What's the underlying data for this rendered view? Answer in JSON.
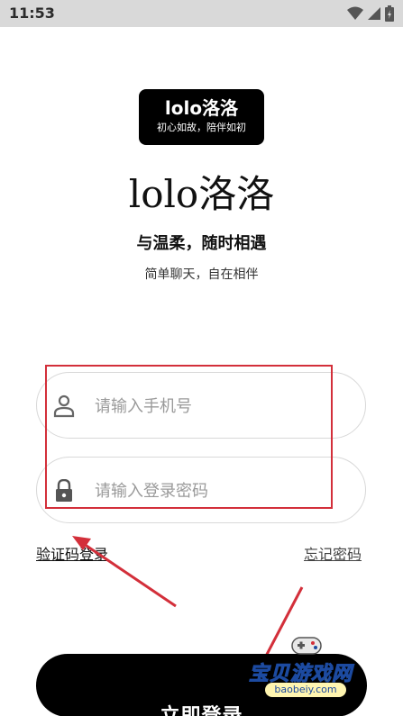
{
  "status_bar": {
    "time": "11:53",
    "icons": [
      "wifi-icon",
      "signal-icon",
      "battery-charging-icon"
    ]
  },
  "logo": {
    "title": "lolo洛洛",
    "subtitle": "初心如故，陪伴如初"
  },
  "hero": {
    "app_name": "lolo洛洛",
    "tagline": "与温柔，随时相遇",
    "sub_tagline": "简单聊天，自在相伴"
  },
  "form": {
    "phone": {
      "placeholder": "请输入手机号",
      "value": "",
      "icon": "user-icon"
    },
    "password": {
      "placeholder": "请输入登录密码",
      "value": "",
      "icon": "lock-icon"
    }
  },
  "links": {
    "code_login": "验证码登录",
    "forgot_password": "忘记密码"
  },
  "login_button": {
    "label": "立即登录"
  },
  "watermark": {
    "text": "宝贝游戏网",
    "url": "baobeiy.com"
  },
  "colors": {
    "annotation_red": "#d32f3a",
    "status_bar_bg": "#d9d9d9",
    "primary_black": "#000000"
  }
}
